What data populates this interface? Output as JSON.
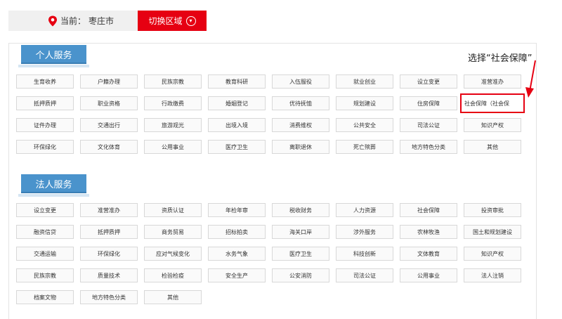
{
  "location": {
    "prefix": "当前：",
    "city": "枣庄市"
  },
  "switch_label": "切换区域",
  "annotation": "选择“社会保障”",
  "personal": {
    "title": "个人服务",
    "items": [
      "生育收养",
      "户籍办理",
      "民族宗教",
      "教育科研",
      "入伍服役",
      "就业创业",
      "设立变更",
      "准营准办",
      "抵押质押",
      "职业资格",
      "行政缴费",
      "婚姻登记",
      "优待抚恤",
      "规划建设",
      "住房保障",
      "社会保障（社会保",
      "证件办理",
      "交通出行",
      "旅游观光",
      "出境入境",
      "消费维权",
      "公共安全",
      "司法公证",
      "知识产权",
      "环保绿化",
      "文化体育",
      "公用事业",
      "医疗卫生",
      "离职退休",
      "死亡殡葬",
      "地方特色分类",
      "其他"
    ],
    "highlight_index": 15
  },
  "legal": {
    "title": "法人服务",
    "items": [
      "设立变更",
      "准营准办",
      "资质认证",
      "年检年审",
      "税收财务",
      "人力资源",
      "社会保障",
      "投资审批",
      "融资信贷",
      "抵押质押",
      "商务贸易",
      "招标拍卖",
      "海关口岸",
      "涉外服务",
      "农林牧渔",
      "国土和规划建设",
      "交通运输",
      "环保绿化",
      "应对气候变化",
      "水务气象",
      "医疗卫生",
      "科技创新",
      "文体教育",
      "知识产权",
      "民族宗教",
      "质量技术",
      "检验检疫",
      "安全生产",
      "公安消防",
      "司法公证",
      "公用事业",
      "法人注销",
      "档案文物",
      "地方特色分类",
      "其他"
    ]
  },
  "colors": {
    "accent_red": "#e60012",
    "tab_blue": "#4a93cc"
  }
}
